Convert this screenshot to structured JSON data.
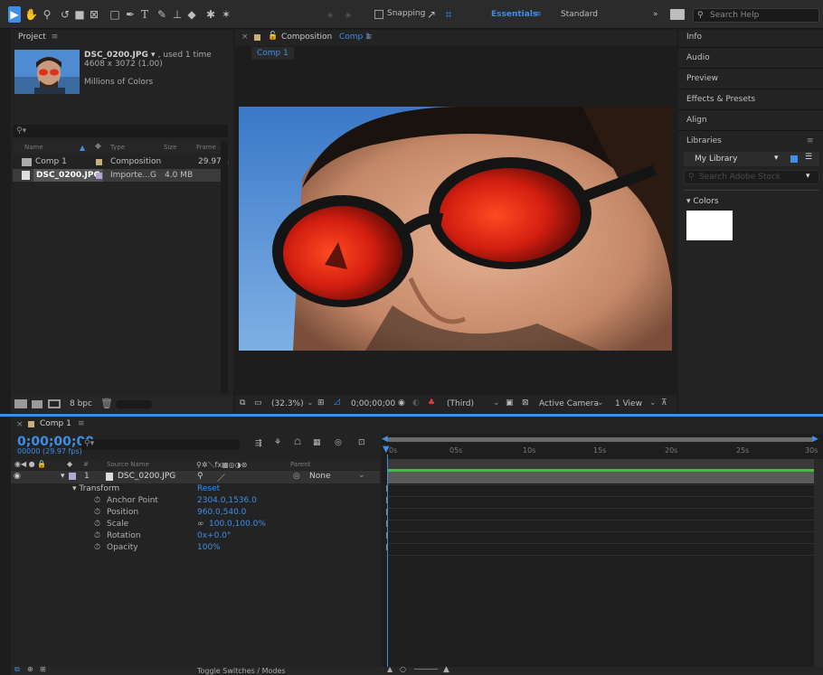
{
  "toolbar": {
    "snapping_label": "Snapping",
    "workspace_active": "Essentials",
    "workspace_other": "Standard",
    "search_placeholder": "Search Help"
  },
  "project": {
    "title": "Project",
    "file_name": "DSC_0200.JPG",
    "file_usage": ", used 1 time",
    "file_dims": "4608 x 3072 (1.00)",
    "file_colors": "Millions of Colors",
    "columns": {
      "name": "Name",
      "type": "Type",
      "size": "Size",
      "frame": "Frame ..."
    },
    "items": [
      {
        "name": "Comp 1",
        "type": "Composition",
        "size": "",
        "frame": "29.97"
      },
      {
        "name": "DSC_0200.JPG",
        "type": "Importe...G",
        "size": "4.0 MB",
        "frame": ""
      }
    ],
    "bpc": "8 bpc"
  },
  "composition": {
    "tab_prefix": "Composition",
    "tab_name": "Comp 1",
    "crumb": "Comp 1",
    "zoom": "(32.3%)",
    "timecode": "0;00;00;00",
    "resolution": "(Third)",
    "camera": "Active Camera",
    "views": "1 View"
  },
  "right_panels": {
    "info": "Info",
    "audio": "Audio",
    "preview": "Preview",
    "effects": "Effects & Presets",
    "align": "Align",
    "libraries": "Libraries",
    "library_name": "My Library",
    "stock_placeholder": "Search Adobe Stock",
    "colors": "Colors"
  },
  "timeline": {
    "tab": "Comp 1",
    "timecode": "0;00;00;00",
    "frames": "00000 (29.97 fps)",
    "cols": {
      "num": "#",
      "source": "Source Name",
      "parent": "Parent"
    },
    "layer": {
      "num": "1",
      "name": "DSC_0200.JPG",
      "parent": "None"
    },
    "transform": "Transform",
    "reset": "Reset",
    "props": [
      {
        "name": "Anchor Point",
        "value": "2304.0,1536.0"
      },
      {
        "name": "Position",
        "value": "960.0,540.0"
      },
      {
        "name": "Scale",
        "value": "100.0,100.0%"
      },
      {
        "name": "Rotation",
        "value": "0x+0.0°"
      },
      {
        "name": "Opacity",
        "value": "100%"
      }
    ],
    "ticks": [
      "0s",
      "05s",
      "10s",
      "15s",
      "20s",
      "25s",
      "30s"
    ],
    "toggle_label": "Toggle Switches / Modes"
  }
}
